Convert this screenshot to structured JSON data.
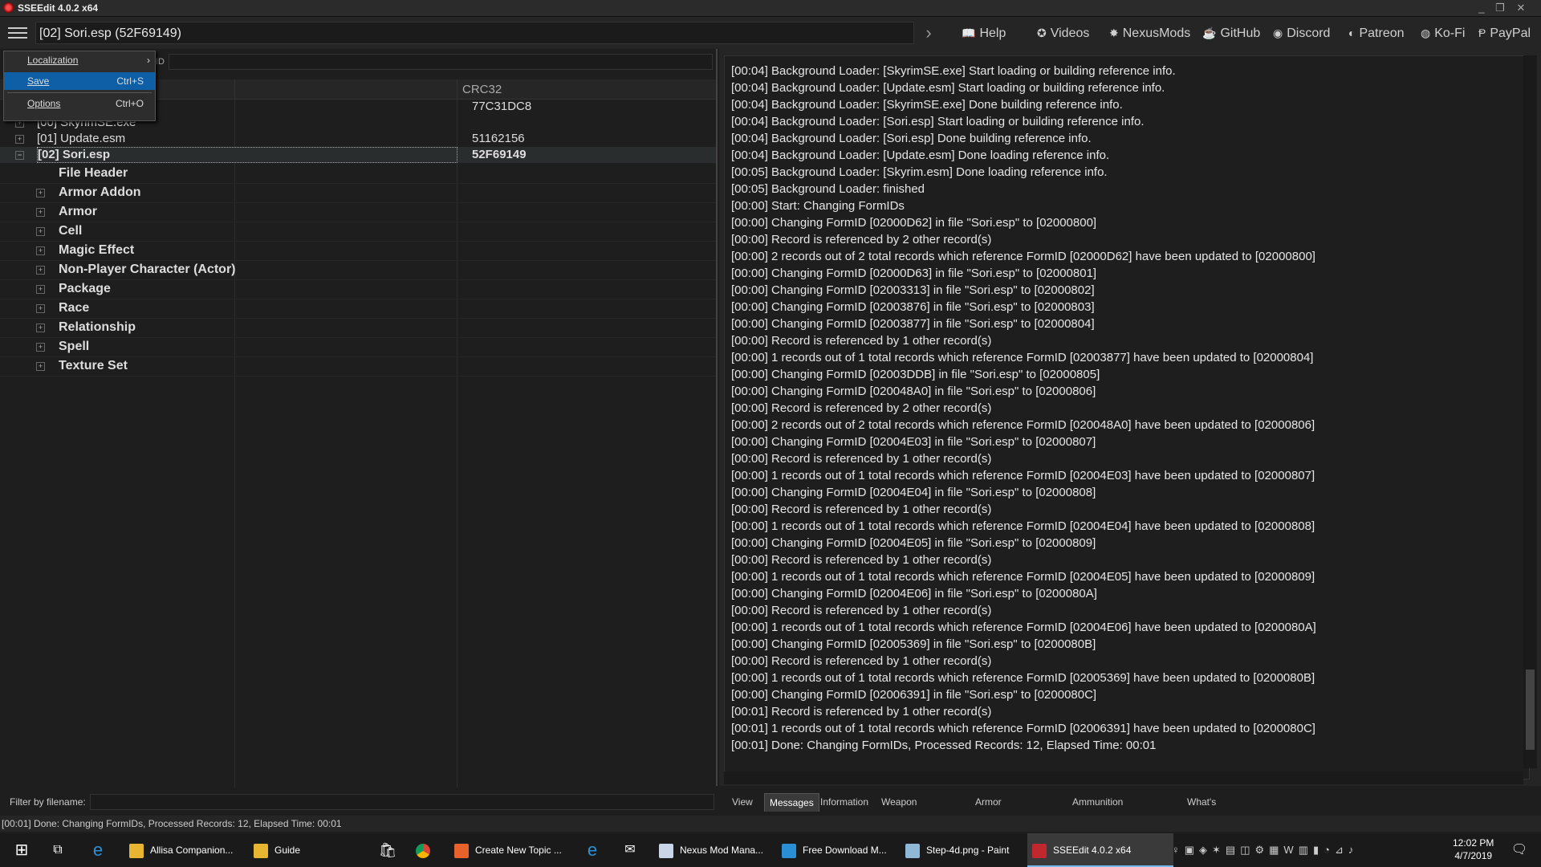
{
  "window": {
    "title": "SSEEdit 4.0.2 x64",
    "min": "_",
    "max": "❐",
    "close": "✕"
  },
  "header": {
    "path": "[02] Sori.esp (52F69149)",
    "links": [
      {
        "label": "Help",
        "icon": "📖"
      },
      {
        "label": "Videos",
        "icon": "✪"
      },
      {
        "label": "NexusMods",
        "icon": "✸"
      },
      {
        "label": "GitHub",
        "icon": "☕"
      },
      {
        "label": "Discord",
        "icon": "◉"
      },
      {
        "label": "Patreon",
        "icon": "◐"
      },
      {
        "label": "Ko-Fi",
        "icon": "◍"
      },
      {
        "label": "PayPal",
        "icon": "Ᵽ"
      }
    ]
  },
  "menu": {
    "items": [
      {
        "label": "Localization",
        "shortcut": "",
        "arrow": "›"
      },
      {
        "label": "Save",
        "shortcut": "Ctrl+S"
      },
      {
        "label": "Options",
        "shortcut": "Ctrl+O"
      }
    ]
  },
  "left": {
    "filter_fid_label": "ID",
    "column_crc": "CRC32",
    "files": [
      {
        "label": "[00] SkyrimSE.exe",
        "crc": "77C31DC8"
      },
      {
        "label": "[00] SkyrimSE.exe",
        "crc": ""
      },
      {
        "label": "[01] Update.esm",
        "crc": "51162156"
      },
      {
        "label": "[02] Sori.esp",
        "crc": "52F69149"
      }
    ],
    "groups": [
      "File Header",
      "Armor Addon",
      "Armor",
      "Cell",
      "Magic Effect",
      "Non-Player Character (Actor)",
      "Package",
      "Race",
      "Relationship",
      "Spell",
      "Texture Set"
    ],
    "filter_name_label": "Filter by filename:"
  },
  "messages": [
    "[00:04] Background Loader: [SkyrimSE.exe] Start loading or building reference info.",
    "[00:04] Background Loader: [Update.esm] Start loading or building reference info.",
    "[00:04] Background Loader: [SkyrimSE.exe] Done building reference info.",
    "[00:04] Background Loader: [Sori.esp] Start loading or building reference info.",
    "[00:04] Background Loader: [Sori.esp] Done building reference info.",
    "[00:04] Background Loader: [Update.esm] Done loading reference info.",
    "[00:05] Background Loader: [Skyrim.esm] Done loading reference info.",
    "[00:05] Background Loader: finished",
    "[00:00] Start: Changing FormIDs",
    "[00:00] Changing FormID [02000D62] in file \"Sori.esp\" to [02000800]",
    "[00:00] Record is referenced by 2 other record(s)",
    "[00:00] 2 records out of 2 total records which reference FormID [02000D62] have been updated to [02000800]",
    "[00:00] Changing FormID [02000D63] in file \"Sori.esp\" to [02000801]",
    "[00:00] Changing FormID [02003313] in file \"Sori.esp\" to [02000802]",
    "[00:00] Changing FormID [02003876] in file \"Sori.esp\" to [02000803]",
    "[00:00] Changing FormID [02003877] in file \"Sori.esp\" to [02000804]",
    "[00:00] Record is referenced by 1 other record(s)",
    "[00:00] 1 records out of 1 total records which reference FormID [02003877] have been updated to [02000804]",
    "[00:00] Changing FormID [02003DDB] in file \"Sori.esp\" to [02000805]",
    "[00:00] Changing FormID [020048A0] in file \"Sori.esp\" to [02000806]",
    "[00:00] Record is referenced by 2 other record(s)",
    "[00:00] 2 records out of 2 total records which reference FormID [020048A0] have been updated to [02000806]",
    "[00:00] Changing FormID [02004E03] in file \"Sori.esp\" to [02000807]",
    "[00:00] Record is referenced by 1 other record(s)",
    "[00:00] 1 records out of 1 total records which reference FormID [02004E03] have been updated to [02000807]",
    "[00:00] Changing FormID [02004E04] in file \"Sori.esp\" to [02000808]",
    "[00:00] Record is referenced by 1 other record(s)",
    "[00:00] 1 records out of 1 total records which reference FormID [02004E04] have been updated to [02000808]",
    "[00:00] Changing FormID [02004E05] in file \"Sori.esp\" to [02000809]",
    "[00:00] Record is referenced by 1 other record(s)",
    "[00:00] 1 records out of 1 total records which reference FormID [02004E05] have been updated to [02000809]",
    "[00:00] Changing FormID [02004E06] in file \"Sori.esp\" to [0200080A]",
    "[00:00] Record is referenced by 1 other record(s)",
    "[00:00] 1 records out of 1 total records which reference FormID [02004E06] have been updated to [0200080A]",
    "[00:00] Changing FormID [02005369] in file \"Sori.esp\" to [0200080B]",
    "[00:00] Record is referenced by 1 other record(s)",
    "[00:00] 1 records out of 1 total records which reference FormID [02005369] have been updated to [0200080B]",
    "[00:00] Changing FormID [02006391] in file \"Sori.esp\" to [0200080C]",
    "[00:01] Record is referenced by 1 other record(s)",
    "[00:01] 1 records out of 1 total records which reference FormID [02006391] have been updated to [0200080C]",
    "[00:01] Done: Changing FormIDs, Processed Records: 12, Elapsed Time: 00:01"
  ],
  "tabs": [
    "View",
    "Messages",
    "Information",
    "Weapon Spreadsheet",
    "Armor Spreadsheet",
    "Ammunition Spreadsheet",
    "What's New"
  ],
  "active_tab": "Messages",
  "status": "[00:01] Done: Changing FormIDs, Processed Records: 12, Elapsed Time: 00:01",
  "taskbar": {
    "items": [
      {
        "label": "Allisa Companion...",
        "icon": "folder-icon",
        "color": "#e8b533"
      },
      {
        "label": "Guide",
        "icon": "folder-icon",
        "color": "#e8b533"
      },
      {
        "label": "Create New Topic ...",
        "icon": "firefox-icon",
        "color": "#e8622c"
      },
      {
        "label": "Nexus Mod Mana...",
        "icon": "nmm-icon",
        "color": "#c9d6e8"
      },
      {
        "label": "Free Download M...",
        "icon": "fdm-icon",
        "color": "#2b8fd6"
      },
      {
        "label": "Step-4d.png - Paint",
        "icon": "paint-icon",
        "color": "#8fb8d6"
      },
      {
        "label": "SSEEdit 4.0.2 x64",
        "icon": "sseedit-icon",
        "color": "#c0282d"
      }
    ],
    "time": "12:02 PM",
    "date": "4/7/2019"
  }
}
